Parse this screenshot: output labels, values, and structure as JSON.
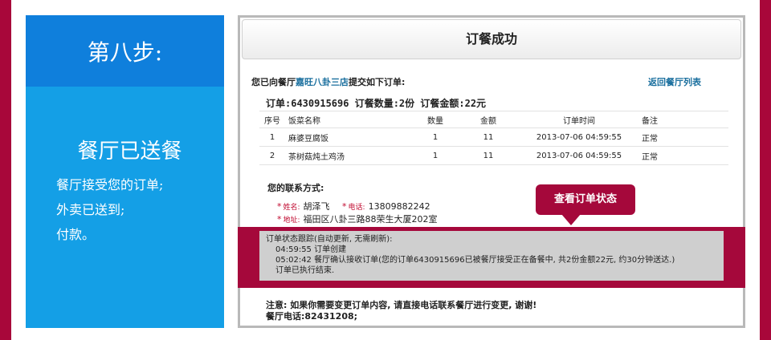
{
  "step": {
    "heading": "第八步:",
    "subheading": "餐厅已送餐",
    "lines": [
      "餐厅接受您的订单;",
      "外卖已送到;",
      "付款。"
    ]
  },
  "order": {
    "title": "订餐成功",
    "intro_prefix": "您已向餐厅",
    "restaurant": "嘉旺八卦三店",
    "intro_suffix": "提交如下订单:",
    "back_link": "返回餐厅列表",
    "summary": "订单:6430915696  订餐数量:2份 订餐金额:22元",
    "columns": [
      "序号",
      "饭菜名称",
      "数量",
      "金额",
      "订单时间",
      "备注"
    ],
    "rows": [
      [
        "1",
        "麻婆豆腐饭",
        "1",
        "11",
        "2013-07-06 04:59:55",
        "正常"
      ],
      [
        "2",
        "茶树菇炖土鸡汤",
        "1",
        "11",
        "2013-07-06 04:59:55",
        "正常"
      ]
    ],
    "contact_title": "您的联系方式:",
    "name_label": "姓名:",
    "name_value": "胡泽飞",
    "phone_label": "电话:",
    "phone_value": "13809882242",
    "address_label": "地址:",
    "address_value": "福田区八卦三路88荣生大厦202室",
    "status_button": "查看订单状态",
    "tracking_title": "订单状态跟踪(自动更新, 无需刷新):",
    "tracking_lines": [
      "04:59:55  订单创建",
      "05:02:42  餐厅确认接收订单(您的订单6430915696已被餐厅接受正在备餐中, 共2份金额22元, 约30分钟送达.)",
      "订单已执行结束."
    ],
    "notice": "注意: 如果你需要变更订单内容, 请直接电话联系餐厅进行变更, 谢谢!",
    "restaurant_phone": "餐厅电话:82431208;"
  },
  "colors": {
    "frame": "#a8073a",
    "step_head": "#0f7fdc",
    "step_body": "#149fe6",
    "accent": "#a5083b",
    "link": "#1a6f9e"
  }
}
